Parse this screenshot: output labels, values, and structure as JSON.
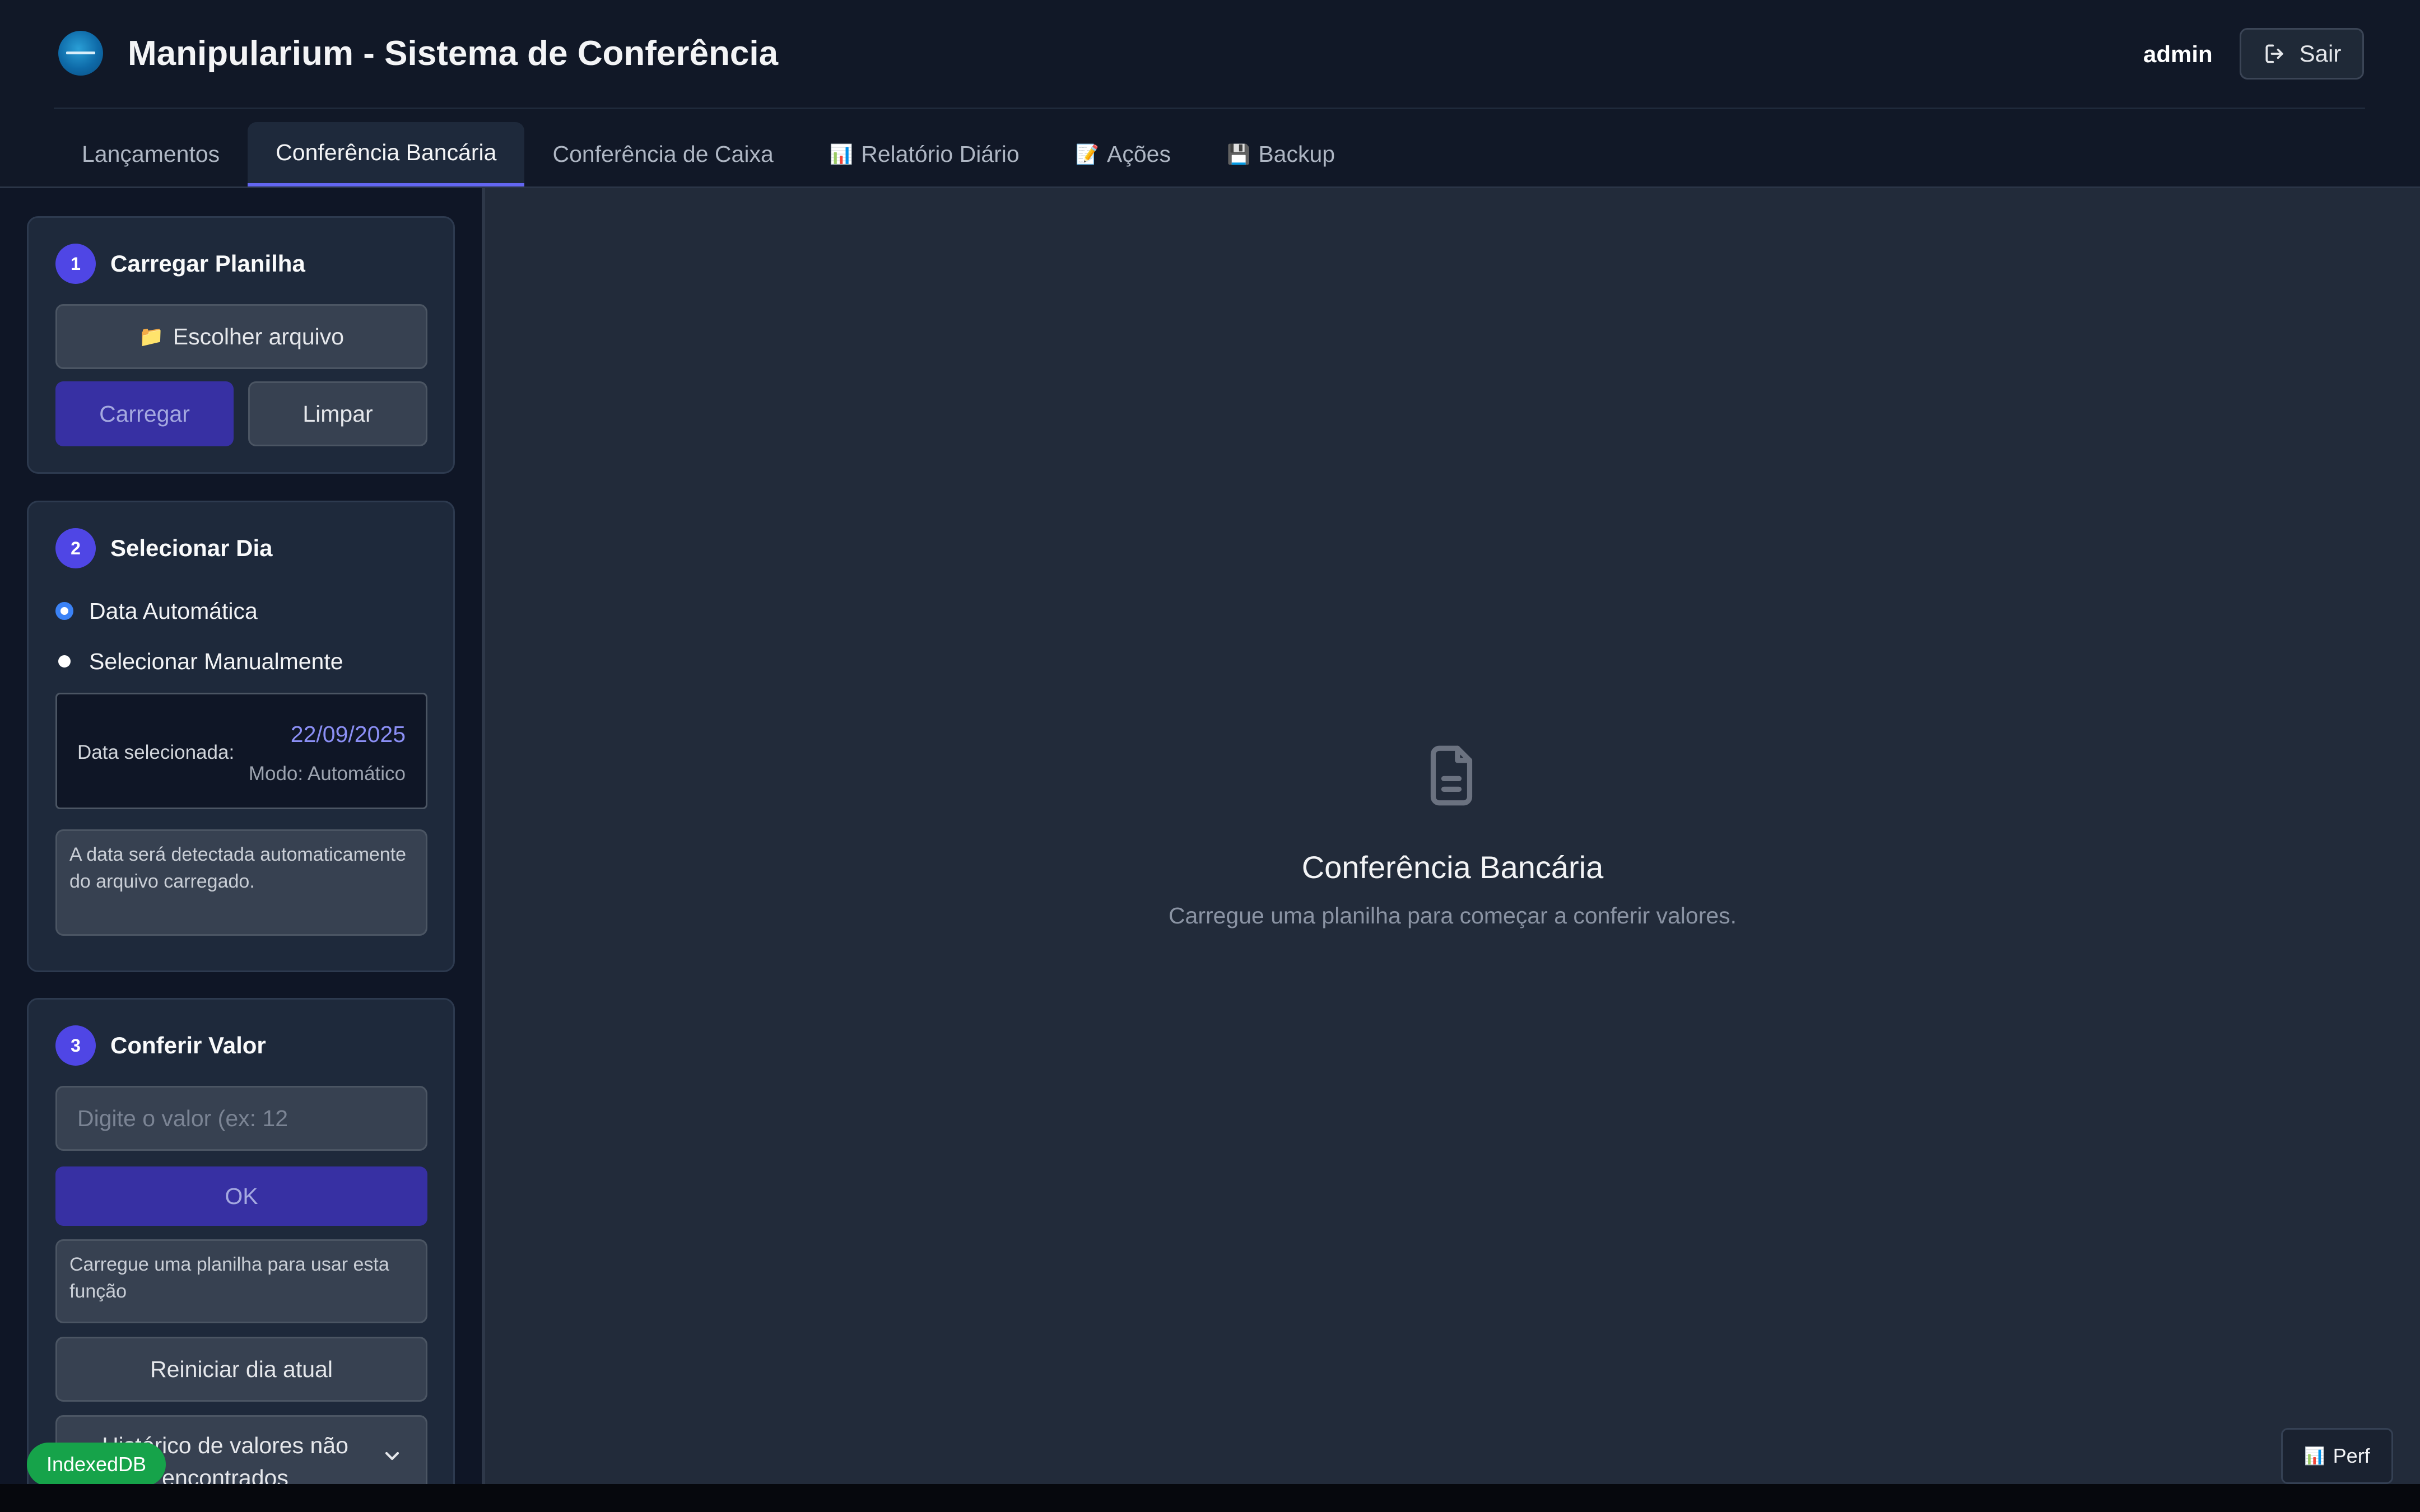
{
  "app": {
    "title": "Manipularium - Sistema de Conferência"
  },
  "user": {
    "name": "admin",
    "logout_label": "Sair"
  },
  "tabs": [
    {
      "label": "Lançamentos",
      "icon": "",
      "active": false
    },
    {
      "label": "Conferência Bancária",
      "icon": "",
      "active": true
    },
    {
      "label": "Conferência de Caixa",
      "icon": "",
      "active": false
    },
    {
      "label": "Relatório Diário",
      "icon": "📊",
      "active": false
    },
    {
      "label": "Ações",
      "icon": "📝",
      "active": false
    },
    {
      "label": "Backup",
      "icon": "💾",
      "active": false
    }
  ],
  "step1": {
    "number": "1",
    "title": "Carregar Planilha",
    "file_icon": "📁",
    "choose_file_label": "Escolher arquivo",
    "load_label": "Carregar",
    "clear_label": "Limpar"
  },
  "step2": {
    "number": "2",
    "title": "Selecionar Dia",
    "option_auto": "Data Automática",
    "option_manual": "Selecionar Manualmente",
    "selected_option": "auto",
    "date_label": "Data selecionada:",
    "date_value": "22/09/2025",
    "mode_text": "Modo: Automático",
    "info": "A data será detectada automaticamente do arquivo carregado."
  },
  "step3": {
    "number": "3",
    "title": "Conferir Valor",
    "input_placeholder": "Digite o valor (ex: 12",
    "ok_label": "OK",
    "info": "Carregue uma planilha para usar esta função",
    "restart_label": "Reiniciar dia atual",
    "not_found_label": "Histórico de valores não encontrados"
  },
  "badges": {
    "storage": "IndexedDB"
  },
  "main": {
    "empty_title": "Conferência Bancária",
    "empty_subtitle": "Carregue uma planilha para começar a conferir valores."
  },
  "perf": {
    "icon": "📊",
    "label": "Perf"
  },
  "colors": {
    "accent": "#6366f1",
    "step_badge": "#4f46e5",
    "primary_button": "#3730a3",
    "date_highlight": "#8b8ff5",
    "success_badge": "#16a34a"
  }
}
